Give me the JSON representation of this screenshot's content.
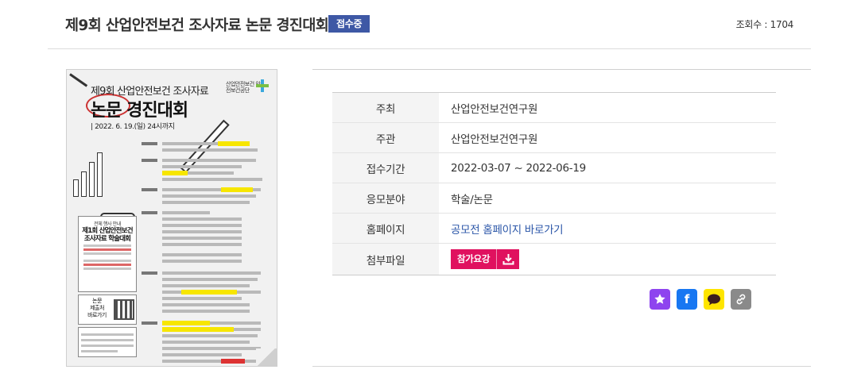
{
  "header": {
    "title": "제9회 산업안전보건 조사자료 논문 경진대회",
    "status_badge": "접수중",
    "views": "조회수 : 1704"
  },
  "poster": {
    "title_line1": "제9회 산업안전보건 조사자료",
    "title_line2": "논문 경진대회",
    "date": "| 2022. 6. 19.(일) 24시까지",
    "org": "산업안전보건 안전보건공단",
    "card_small": "전체 행사 안내",
    "card_title_1": "제1회 산업안전보건",
    "card_title_2": "조사자료 학술대회",
    "qr_text_1": "논문",
    "qr_text_2": "제출처",
    "qr_text_3": "바로가기"
  },
  "info": {
    "rows": [
      {
        "label": "주최",
        "value": "산업안전보건연구원"
      },
      {
        "label": "주관",
        "value": "산업안전보건연구원"
      },
      {
        "label": "접수기간",
        "value": "2022-03-07 ~ 2022-06-19"
      },
      {
        "label": "응모분야",
        "value": "학술/논문"
      },
      {
        "label": "홈페이지",
        "value": "공모전 홈페이지 바로가기"
      },
      {
        "label": "첨부파일",
        "value": ""
      }
    ],
    "attachment_button": "참가요강"
  },
  "share": {
    "icons": [
      "star-icon",
      "facebook-icon",
      "kakaotalk-icon",
      "link-icon"
    ],
    "colors": {
      "star": "#8e44ef",
      "facebook": "#1877f2",
      "kakao": "#fee500",
      "link": "#8a8a8a"
    }
  }
}
